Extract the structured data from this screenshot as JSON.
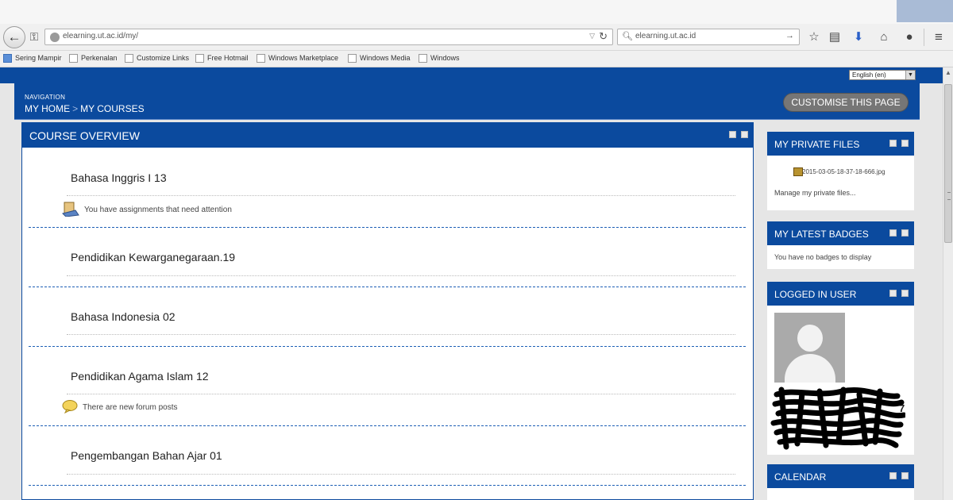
{
  "browser": {
    "url": "elearning.ut.ac.id/my/",
    "search_query": "elearning.ut.ac.id",
    "bookmarks": [
      {
        "label": "Sering Mampir"
      },
      {
        "label": "Perkenalan"
      },
      {
        "label": "Customize Links"
      },
      {
        "label": "Free Hotmail"
      },
      {
        "label": "Windows Marketplace"
      },
      {
        "label": "Windows Media"
      },
      {
        "label": "Windows"
      }
    ],
    "icons": [
      "back-icon",
      "key-icon",
      "globe-icon",
      "reload-icon",
      "search-icon",
      "star-icon",
      "clipboard-icon",
      "download-icon",
      "home-icon",
      "chat-icon",
      "menu-icon"
    ]
  },
  "site": {
    "language": "English (en)",
    "navigation_label": "NAVIGATION",
    "breadcrumb": [
      "MY HOME",
      "MY COURSES"
    ],
    "breadcrumb_separator": ">",
    "customise_label": "CUSTOMISE THIS PAGE"
  },
  "overview": {
    "title": "COURSE OVERVIEW",
    "courses": [
      {
        "name": "Bahasa Inggris I 13",
        "note": "You have assignments that need attention",
        "note_icon": "assignment-icon"
      },
      {
        "name": "Pendidikan Kewarganegaraan.19",
        "note": "",
        "note_icon": ""
      },
      {
        "name": "Bahasa Indonesia 02",
        "note": "",
        "note_icon": ""
      },
      {
        "name": "Pendidikan Agama Islam 12",
        "note": "There are new forum posts",
        "note_icon": "forum-icon"
      },
      {
        "name": "Pengembangan Bahan Ajar 01",
        "note": "",
        "note_icon": ""
      }
    ]
  },
  "sidebar": {
    "private_files": {
      "title": "MY PRIVATE FILES",
      "file": "2015-03-05-18-37-18-666.jpg",
      "manage_link": "Manage my private files..."
    },
    "badges": {
      "title": "MY LATEST BADGES",
      "empty_text": "You have no badges to display"
    },
    "logged_in": {
      "title": "LOGGED IN USER",
      "name_suffix": "7"
    },
    "calendar": {
      "title": "CALENDAR"
    }
  },
  "colors": {
    "brand_blue": "#0b4a9e",
    "button_grey": "#767676",
    "dash_blue": "#1d5fb5"
  }
}
